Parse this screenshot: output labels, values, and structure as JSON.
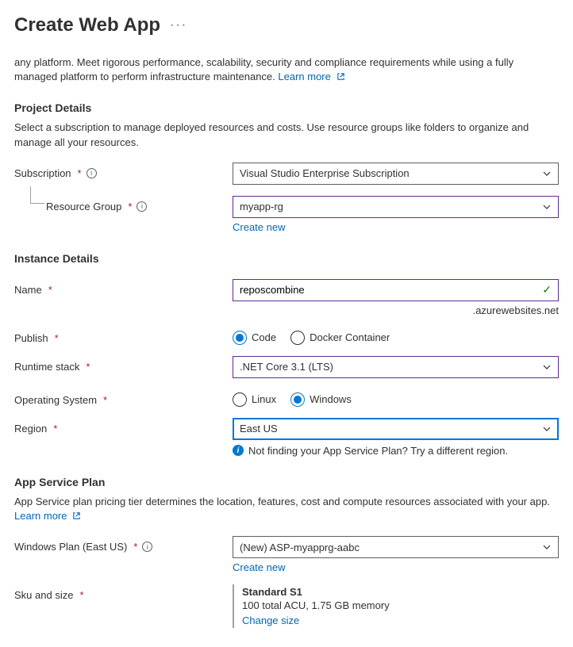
{
  "header": {
    "title": "Create Web App",
    "more": "···"
  },
  "intro": {
    "text": "any platform. Meet rigorous performance, scalability, security and compliance requirements while using a fully managed platform to perform infrastructure maintenance.  ",
    "learn_more": "Learn more"
  },
  "project_details": {
    "heading": "Project Details",
    "desc": "Select a subscription to manage deployed resources and costs. Use resource groups like folders to organize and manage all your resources.",
    "subscription_label": "Subscription",
    "subscription_value": "Visual Studio Enterprise Subscription",
    "resource_group_label": "Resource Group",
    "resource_group_value": "myapp-rg",
    "create_new": "Create new"
  },
  "instance_details": {
    "heading": "Instance Details",
    "name_label": "Name",
    "name_value": "reposcombine",
    "suffix": ".azurewebsites.net",
    "publish_label": "Publish",
    "publish_code": "Code",
    "publish_docker": "Docker Container",
    "runtime_label": "Runtime stack",
    "runtime_value": ".NET Core 3.1 (LTS)",
    "os_label": "Operating System",
    "os_linux": "Linux",
    "os_windows": "Windows",
    "region_label": "Region",
    "region_value": "East US",
    "region_hint": "Not finding your App Service Plan? Try a different region."
  },
  "app_service_plan": {
    "heading": "App Service Plan",
    "desc": "App Service plan pricing tier determines the location, features, cost and compute resources associated with your app. ",
    "learn_more": "Learn more",
    "plan_label": "Windows Plan (East US)",
    "plan_value": "(New) ASP-myapprg-aabc",
    "create_new": "Create new",
    "sku_label": "Sku and size",
    "sku_title": "Standard S1",
    "sku_sub": "100 total ACU, 1.75 GB memory",
    "change_size": "Change size"
  }
}
